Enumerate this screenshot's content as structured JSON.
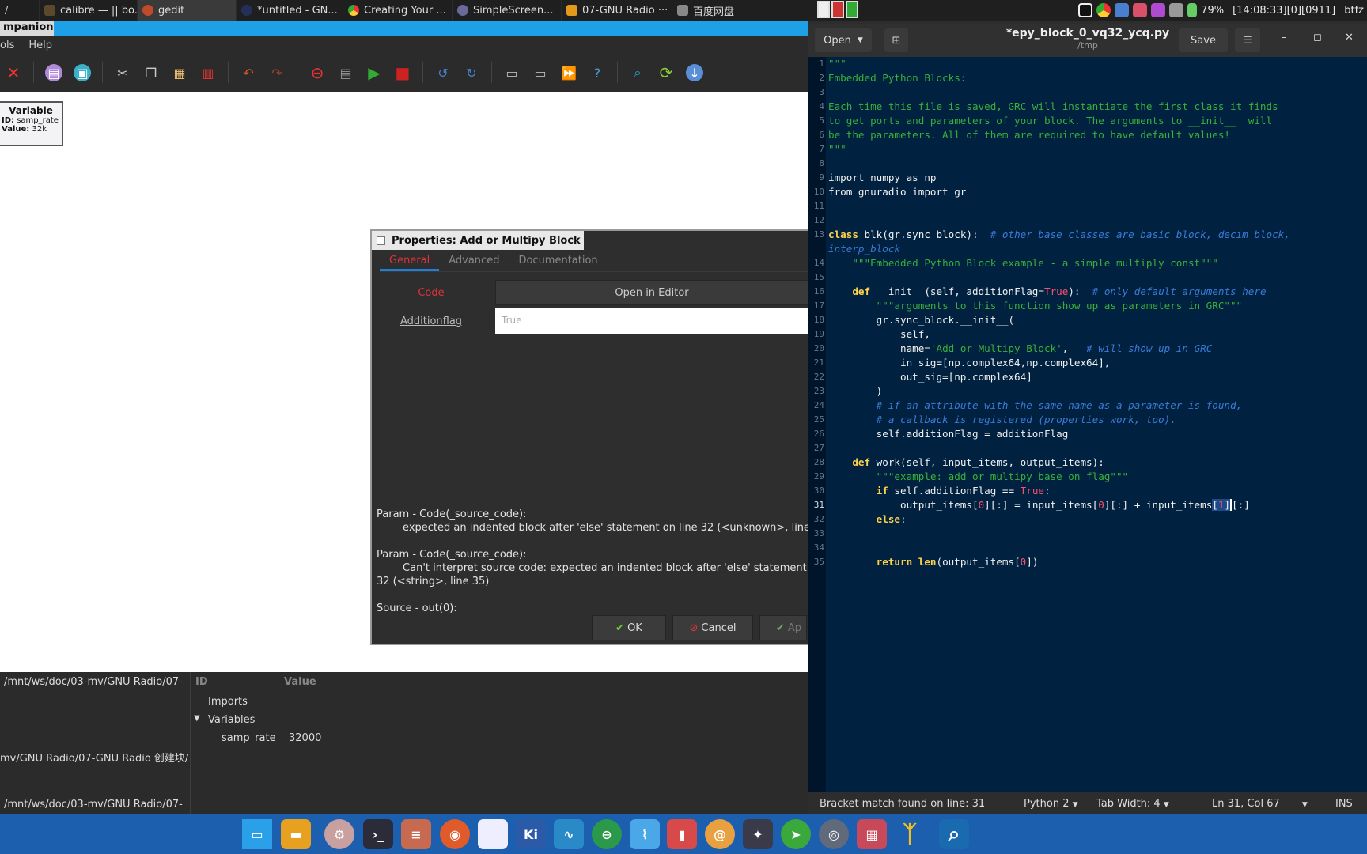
{
  "taskbar_tabs": [
    {
      "label": "calibre — || bo...",
      "color": "#5a4a2a"
    },
    {
      "label": "gedit",
      "color": "#c04b2a",
      "active": true
    },
    {
      "label": "*untitled - GN...",
      "color": "#24305a"
    },
    {
      "label": "Creating Your ...",
      "color": "#3d8f3d"
    },
    {
      "label": "SimpleScreen...",
      "color": "#6a6a9a"
    },
    {
      "label": "07-GNU Radio ···",
      "color": "#e39a1a"
    },
    {
      "label": "百度网盘",
      "color": "#888888"
    }
  ],
  "tray": {
    "battery": "79%",
    "clock": "[14:08:33][0][0911]",
    "user": "btfz"
  },
  "grc": {
    "title": "mpanion",
    "menu": [
      "ols",
      "Help"
    ],
    "variable_block": {
      "title": "Variable",
      "id_label": "ID:",
      "id_value": "samp_rate",
      "value_label": "Value:",
      "value_value": "32k"
    },
    "paths": [
      "/mnt/ws/doc/03-mv/GNU Radio/07-",
      "mv/GNU Radio/07-GNU Radio 创建块/",
      "/mnt/ws/doc/03-mv/GNU Radio/07-"
    ],
    "vars_header": {
      "id": "ID",
      "value": "Value"
    },
    "vars_tree": {
      "imports": "Imports",
      "variables": "Variables",
      "samp_rate_label": "samp_rate",
      "samp_rate_value": "32000"
    }
  },
  "dialog": {
    "title": "Properties: Add or Multipy Block",
    "tabs": [
      "General",
      "Advanced",
      "Documentation"
    ],
    "code_label": "Code",
    "open_in_editor": "Open in Editor",
    "flag_label": "Additionflag",
    "flag_value": "True",
    "errors": "Param - Code(_source_code):\n        expected an indented block after 'else' statement on line 32 (<unknown>, line\n\nParam - Code(_source_code):\n        Can't interpret source code: expected an indented block after 'else' statement o\n32 (<string>, line 35)\n\nSource - out(0):",
    "ok": "OK",
    "cancel": "Cancel",
    "apply": "Ap"
  },
  "gedit": {
    "open": "Open",
    "filename": "*epy_block_0_vq32_ycq.py",
    "path": "/tmp",
    "save": "Save",
    "status_msg": "Bracket match found on line: 31",
    "language": "Python 2",
    "tab_width": "Tab Width: 4",
    "position": "Ln 31, Col 67",
    "mode": "INS",
    "lines": [
      "1",
      "2",
      "3",
      "4",
      "5",
      "6",
      "7",
      "8",
      "9",
      "10",
      "11",
      "12",
      "13",
      "",
      "14",
      "15",
      "16",
      "17",
      "18",
      "19",
      "20",
      "21",
      "22",
      "23",
      "24",
      "25",
      "26",
      "27",
      "28",
      "29",
      "30",
      "31",
      "32",
      "33",
      "34",
      "35"
    ]
  }
}
